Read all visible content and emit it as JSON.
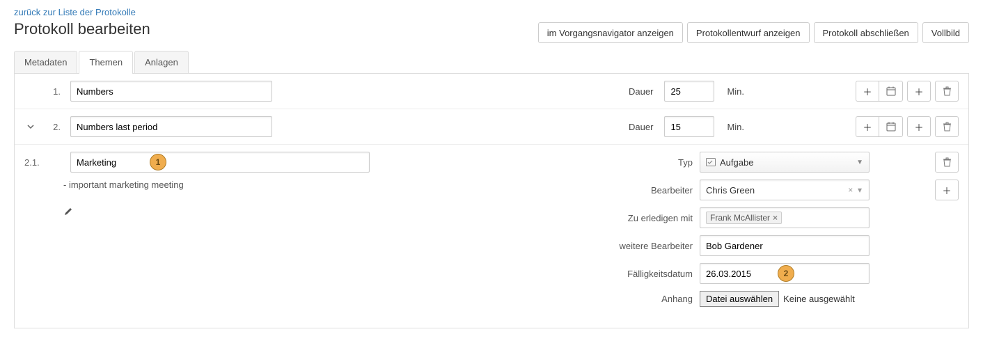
{
  "header": {
    "back_link": "zurück zur Liste der Protokolle",
    "title": "Protokoll bearbeiten",
    "buttons": {
      "show_navigator": "im Vorgangsnavigator anzeigen",
      "show_draft": "Protokollentwurf anzeigen",
      "close_protocol": "Protokoll abschließen",
      "fullscreen": "Vollbild"
    }
  },
  "tabs": {
    "metadata": "Metadaten",
    "topics": "Themen",
    "attachments": "Anlagen"
  },
  "duration_label": "Dauer",
  "duration_suffix": "Min.",
  "topics": [
    {
      "number": "1.",
      "title": "Numbers",
      "duration": "25"
    },
    {
      "number": "2.",
      "title": "Numbers last period",
      "duration": "15"
    }
  ],
  "sub": {
    "number": "2.1.",
    "title": "Marketing",
    "note": "- important marketing meeting",
    "fields": {
      "type_label": "Typ",
      "type_value": "Aufgabe",
      "assignee_label": "Bearbeiter",
      "assignee_value": "Chris Green",
      "with_label": "Zu erledigen mit",
      "with_value": "Frank McAllister",
      "more_label": "weitere Bearbeiter",
      "more_value": "Bob Gardener",
      "due_label": "Fälligkeitsdatum",
      "due_value": "26.03.2015",
      "attach_label": "Anhang",
      "attach_button": "Datei auswählen",
      "attach_status": "Keine ausgewählt"
    },
    "badges": {
      "one": "1",
      "two": "2"
    }
  }
}
